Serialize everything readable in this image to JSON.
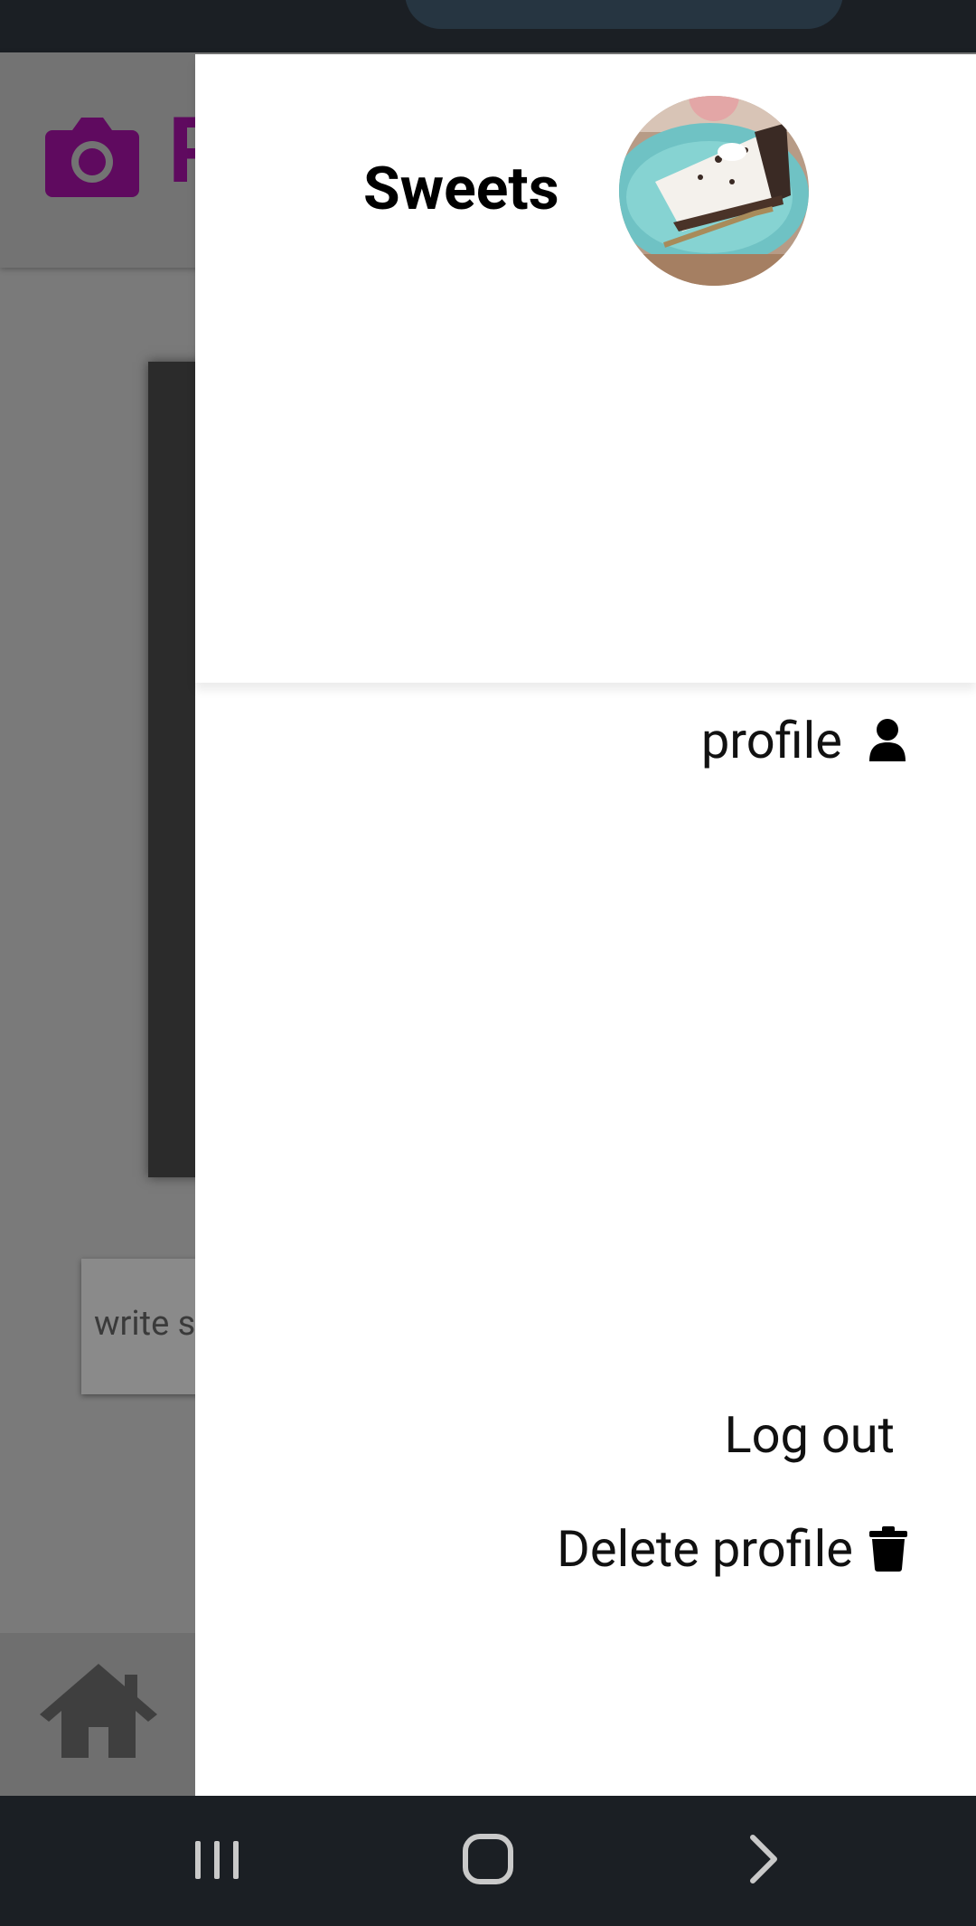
{
  "background_app": {
    "title_fragment": "P",
    "input_placeholder_fragment": "write s"
  },
  "drawer": {
    "username": "Sweets",
    "avatar_alt": "cake slice photo",
    "items": {
      "profile": "profile",
      "logout": "Log out",
      "delete": "Delete profile"
    }
  },
  "icons": {
    "camera": "camera-icon",
    "home": "home-icon",
    "user": "user-icon",
    "trash": "trash-icon",
    "recents": "recents-icon",
    "home_nav": "home-nav-icon",
    "back": "back-icon"
  },
  "colors": {
    "brand_purple": "#800080",
    "system_bar": "#1b1f24"
  }
}
